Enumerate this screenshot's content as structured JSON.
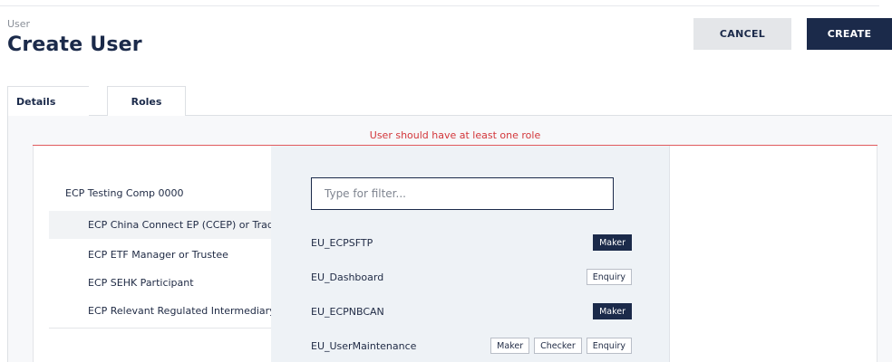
{
  "header": {
    "breadcrumb": "User",
    "title": "Create User",
    "cancel_label": "CANCEL",
    "create_label": "CREATE"
  },
  "tabs": [
    {
      "label": "Details",
      "active": false
    },
    {
      "label": "Roles",
      "active": true
    }
  ],
  "roles_panel": {
    "error_message": "User should have at least one role",
    "company": "ECP Testing Comp 0000",
    "sub_items": [
      {
        "label": "ECP China Connect EP (CCEP) or Trading Participant",
        "selected": true
      },
      {
        "label": "ECP ETF Manager or Trustee",
        "selected": false
      },
      {
        "label": "ECP SEHK Participant",
        "selected": false
      },
      {
        "label": "ECP Relevant Regulated Intermediary",
        "selected": false
      }
    ],
    "filter": {
      "placeholder": "Type for filter...",
      "value": ""
    },
    "roles": [
      {
        "name": "EU_ECPSFTP",
        "badges": [
          {
            "label": "Maker",
            "active": true
          }
        ]
      },
      {
        "name": "EU_Dashboard",
        "badges": [
          {
            "label": "Enquiry",
            "active": false
          }
        ]
      },
      {
        "name": "EU_ECPNBCAN",
        "badges": [
          {
            "label": "Maker",
            "active": true
          }
        ]
      },
      {
        "name": "EU_UserMaintenance",
        "badges": [
          {
            "label": "Maker",
            "active": false
          },
          {
            "label": "Checker",
            "active": false
          },
          {
            "label": "Enquiry",
            "active": false
          }
        ]
      }
    ]
  },
  "colors": {
    "primary": "#1b2a4a",
    "error": "#d3363a",
    "secondary_button": "#e4e6e9",
    "dropdown_bg": "#eef2f6"
  }
}
